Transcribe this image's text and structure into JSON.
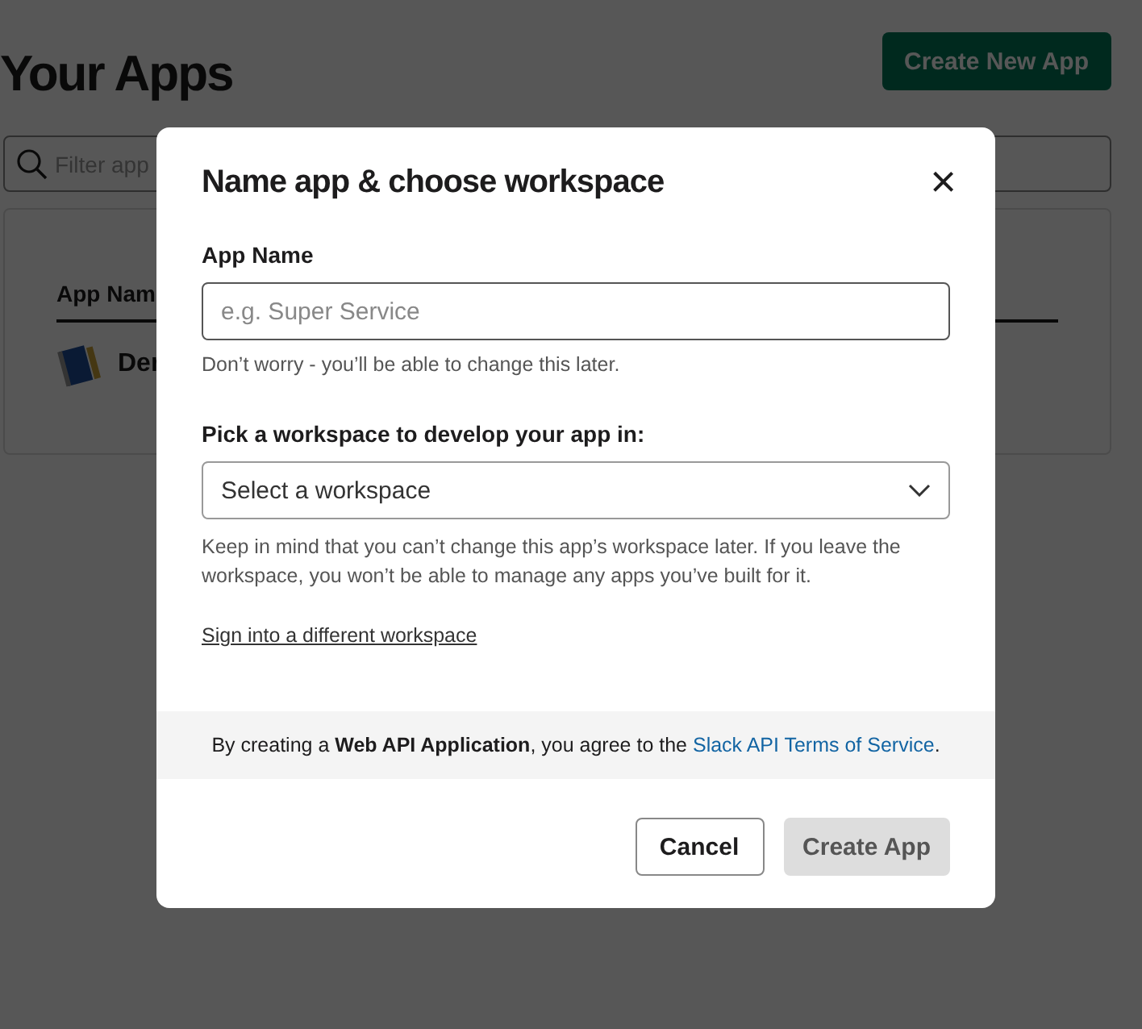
{
  "page": {
    "title": "Your Apps",
    "create_button": "Create New App",
    "filter": {
      "placeholder": "Filter app"
    },
    "table": {
      "columns": [
        "App Nam"
      ],
      "rows": [
        {
          "name": "Der"
        }
      ]
    }
  },
  "modal": {
    "title": "Name app & choose workspace",
    "close": "×",
    "app_name": {
      "label": "App Name",
      "placeholder": "e.g. Super Service",
      "hint": "Don’t worry - you’ll be able to change this later."
    },
    "workspace": {
      "label": "Pick a workspace to develop your app in:",
      "placeholder": "Select a workspace",
      "note": "Keep in mind that you can’t change this app’s workspace later. If you leave the workspace, you won’t be able to manage any apps you’ve built for it.",
      "link": "Sign into a different workspace"
    },
    "terms": {
      "text": "By creating a **Web API Application**, you agree to the",
      "link": "Slack API Terms of Service",
      "end": "."
    },
    "buttons": [
      {
        "label": "Cancel",
        "kind": "secondary",
        "disabled": false
      },
      {
        "label": "Create App",
        "kind": "primary",
        "disabled": true
      }
    ]
  }
}
